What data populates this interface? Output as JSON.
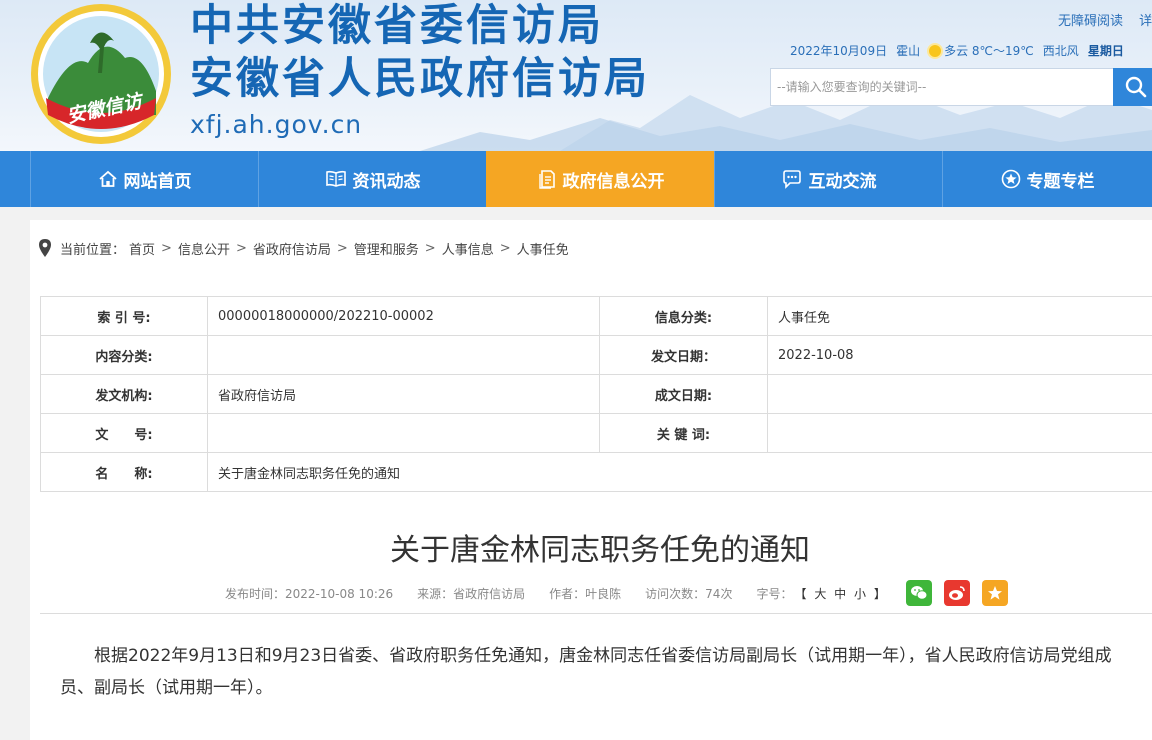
{
  "header": {
    "title_line1": "中共安徽省委信访局",
    "title_line2": "安徽省人民政府信访局",
    "domain": "xfj.ah.gov.cn",
    "logo_text": "安徽信访",
    "top_links": [
      "无障碍阅读",
      "详细"
    ],
    "weather": {
      "date": "2022年10月09日",
      "city": "霍山",
      "condition": "多云 8℃～19℃",
      "wind": "西北风",
      "weekday": "星期日",
      "icon": "sun-cloud-icon"
    },
    "search": {
      "placeholder": "--请输入您要查询的关键词--",
      "icon": "search-icon"
    }
  },
  "nav": {
    "items": [
      {
        "label": "网站首页",
        "icon": "home-icon",
        "active": false
      },
      {
        "label": "资讯动态",
        "icon": "book-icon",
        "active": false
      },
      {
        "label": "政府信息公开",
        "icon": "document-icon",
        "active": true
      },
      {
        "label": "互动交流",
        "icon": "chat-icon",
        "active": false
      },
      {
        "label": "专题专栏",
        "icon": "star-icon",
        "active": false
      }
    ],
    "colors": {
      "bar": "#2f86da",
      "active": "#f5a623"
    }
  },
  "breadcrumb": {
    "prefix": "当前位置：",
    "items": [
      "首页",
      "信息公开",
      "省政府信访局",
      "管理和服务",
      "人事信息",
      "人事任免"
    ]
  },
  "meta": {
    "index_label": "索 引 号:",
    "index_value": "00000018000000/202210-00002",
    "category_label": "信息分类:",
    "category_value": "人事任免",
    "content_label": "内容分类:",
    "content_value": "",
    "pubdate_label": "发文日期：",
    "pubdate_value": "2022-10-08",
    "org_label": "发文机构:",
    "org_value": "省政府信访局",
    "createdate_label": "成文日期:",
    "createdate_value": "",
    "docno_label": "文　　号:",
    "docno_value": "",
    "keywords_label": "关 键 词:",
    "keywords_value": "",
    "name_label": "名　　称:",
    "name_value": "关于唐金林同志职务任免的通知"
  },
  "article": {
    "title": "关于唐金林同志职务任免的通知",
    "publish_time": "发布时间：2022-10-08 10:26",
    "source": "来源：省政府信访局",
    "author": "作者：叶良陈",
    "visits": "访问次数：74次",
    "fontsize_label": "字号：",
    "fontsize_options": [
      "【",
      "大",
      "中",
      "小",
      "】"
    ],
    "share_icons": [
      "wechat-icon",
      "weibo-icon",
      "favorite-icon"
    ],
    "share_colors": [
      "#3fb63a",
      "#e8382f",
      "#f5a623"
    ],
    "body": "根据2022年9月13日和9月23日省委、省政府职务任免通知，唐金林同志任省委信访局副局长（试用期一年），省人民政府信访局党组成员、副局长（试用期一年）。"
  }
}
